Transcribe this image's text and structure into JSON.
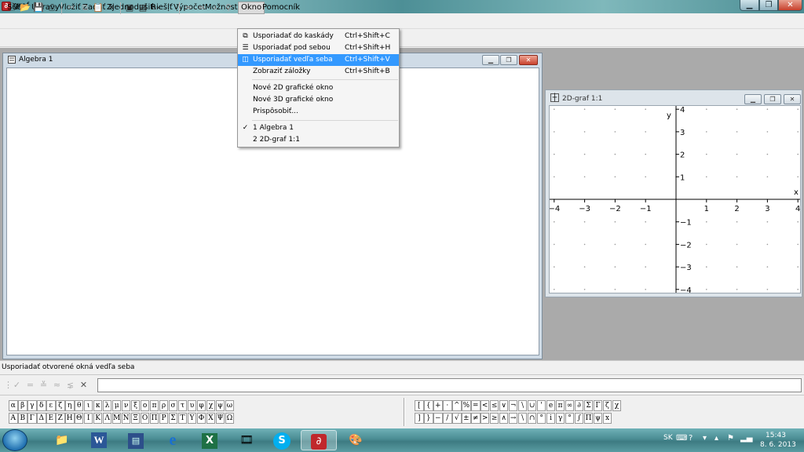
{
  "window": {
    "title": "graf",
    "icon": "app-icon"
  },
  "menubar": [
    "Súbor",
    "Úpravy",
    "Vložiť",
    "Zadať",
    "Zjednodušiť",
    "Riešiť",
    "Výpočet",
    "Možnosti",
    "Okno",
    "Pomocník"
  ],
  "okno_menu": {
    "items": [
      {
        "label": "Usporiadať do kaskády",
        "shortcut": "Ctrl+Shift+C",
        "icon": "cascade-icon"
      },
      {
        "label": "Usporiadať pod sebou",
        "shortcut": "Ctrl+Shift+H",
        "icon": "tile-horizontal-icon"
      },
      {
        "label": "Usporiadať vedľa seba",
        "shortcut": "Ctrl+Shift+V",
        "icon": "tile-vertical-icon",
        "highlighted": true
      },
      {
        "label": "Zobraziť záložky",
        "shortcut": "Ctrl+Shift+B"
      },
      {
        "label": "Nové 2D grafické okno",
        "shortcut": ""
      },
      {
        "label": "Nové 3D grafické okno",
        "shortcut": ""
      },
      {
        "label": "Prispôsobiť...",
        "shortcut": ""
      },
      {
        "label": "1 Algebra 1",
        "shortcut": "",
        "checked": true
      },
      {
        "label": "2 2D-graf 1:1",
        "shortcut": ""
      }
    ]
  },
  "algebra_window": {
    "title": "Algebra 1"
  },
  "graph_window": {
    "title": "2D-graf 1:1",
    "x_label": "x",
    "y_label": "y",
    "x_ticks": [
      "−4",
      "−3",
      "−2",
      "−1",
      "1",
      "2",
      "3",
      "4"
    ],
    "y_ticks": [
      "4",
      "3",
      "2",
      "1",
      "−1",
      "−2",
      "−3",
      "−4"
    ],
    "xlim": [
      -4,
      4
    ],
    "ylim": [
      -4,
      4
    ]
  },
  "status": {
    "text": "Usporiadať otvorené okná vedľa seba"
  },
  "input": {
    "value": ""
  },
  "greek_lower": [
    "α",
    "β",
    "γ",
    "δ",
    "ε",
    "ζ",
    "η",
    "θ",
    "ι",
    "κ",
    "λ",
    "μ",
    "ν",
    "ξ",
    "ο",
    "π",
    "ρ",
    "σ",
    "τ",
    "υ",
    "φ",
    "χ",
    "ψ",
    "ω"
  ],
  "greek_upper": [
    "Α",
    "Β",
    "Γ",
    "Δ",
    "Ε",
    "Ζ",
    "Η",
    "Θ",
    "Ι",
    "Κ",
    "Λ",
    "Μ",
    "Ν",
    "Ξ",
    "Ο",
    "Π",
    "Ρ",
    "Σ",
    "Τ",
    "Υ",
    "Φ",
    "Χ",
    "Ψ",
    "Ω"
  ],
  "ops_row1": [
    "[",
    "{",
    "+",
    "·",
    "^",
    "%",
    "=",
    "<",
    "≤",
    "∨",
    "¬",
    "\\",
    "∪",
    "'",
    "e",
    "π",
    "∞",
    "∂",
    "Σ",
    "Γ",
    "ζ",
    "χ"
  ],
  "ops_row2": [
    "]",
    "}",
    "−",
    "/",
    "√",
    "±",
    "≠",
    ">",
    "≥",
    "∧",
    "→",
    "\\",
    "∩",
    "°",
    "i",
    "γ",
    "°",
    "∫",
    "Π",
    "ψ",
    "x"
  ],
  "taskbar": {
    "apps": [
      "explorer-icon",
      "word-icon",
      "save-icon",
      "ie-icon",
      "excel-icon",
      "media-icon",
      "skype-icon",
      "graf-icon",
      "paint-icon"
    ],
    "lang": "SK",
    "time": "15:43",
    "date": "8. 6. 2013"
  },
  "colors": {
    "highlight": "#3399ff",
    "app_accent": "#c0282c"
  }
}
